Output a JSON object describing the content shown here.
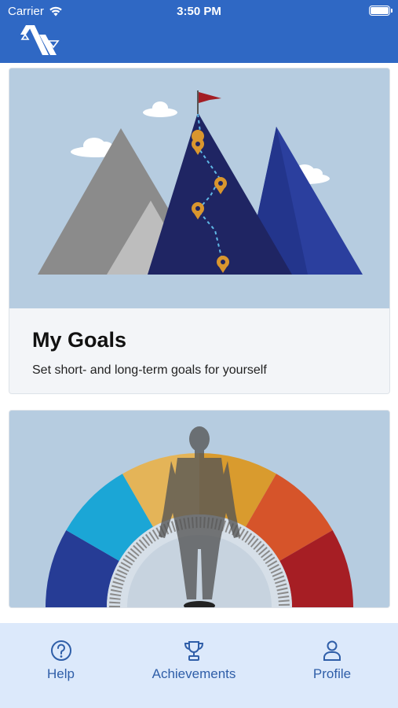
{
  "status_bar": {
    "carrier": "Carrier",
    "time": "3:50 PM"
  },
  "cards": [
    {
      "title": "My Goals",
      "description": "Set short- and long-term goals for yourself",
      "image": "mountain-goals-illustration"
    },
    {
      "title": "",
      "description": "",
      "image": "body-gauge-illustration"
    }
  ],
  "tabbar": {
    "help_label": "Help",
    "achievements_label": "Achievements",
    "profile_label": "Profile"
  },
  "icons": {
    "help": "question-circle-icon",
    "achievements": "trophy-icon",
    "profile": "person-icon",
    "logo": "app-logo"
  },
  "colors": {
    "header": "#2f68c4",
    "tabbar": "#dce9fb",
    "tab_accent": "#2f5ea8",
    "card_image_bg": "#b6cce0"
  }
}
